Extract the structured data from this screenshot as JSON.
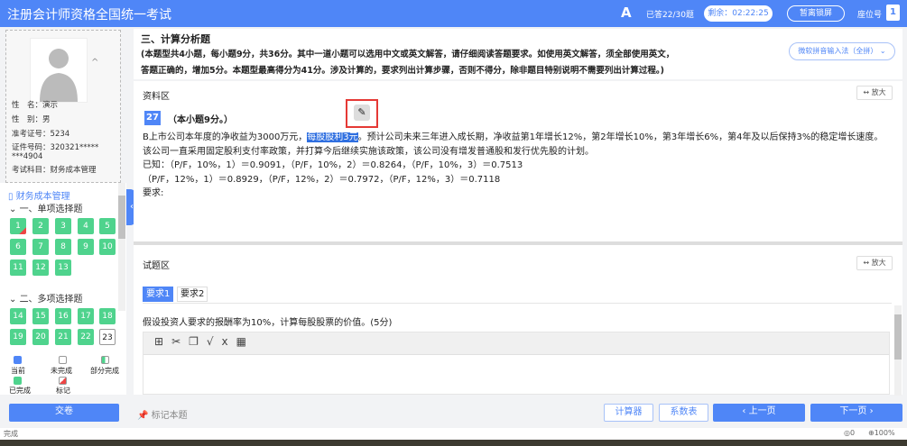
{
  "header": {
    "title": "注册会计师资格全国统一考试",
    "font_icon": "A",
    "answered": "已答22/30题",
    "remaining": "剩余：02:22:25",
    "leave": "暂离锁屏",
    "seat_label": "座位号",
    "seat_no": "1"
  },
  "candidate": {
    "rows": [
      {
        "k": "性　名",
        "v": "演示"
      },
      {
        "k": "性　别",
        "v": "男"
      },
      {
        "k": "准考证号",
        "v": "5234"
      },
      {
        "k": "证件号码",
        "v": "320321********4904"
      },
      {
        "k": "考试科目",
        "v": "财务成本管理"
      }
    ]
  },
  "nav": {
    "subject": "财务成本管理",
    "sections": [
      {
        "title": "一、单项选择题",
        "items": [
          "1",
          "2",
          "3",
          "4",
          "5",
          "6",
          "7",
          "8",
          "9",
          "10",
          "11",
          "12",
          "13"
        ]
      },
      {
        "title": "二、多项选择题",
        "items": [
          "14",
          "15",
          "16",
          "17",
          "18",
          "19",
          "20",
          "21",
          "22",
          "23"
        ]
      }
    ],
    "legend": {
      "current": "当前",
      "incomplete": "未完成",
      "partial": "部分完成",
      "done": "已完成",
      "marked": "标记"
    },
    "submit": "交卷"
  },
  "section": {
    "title": "三、计算分析题",
    "desc1": "(本题型共4小题，每小题9分，共36分。其中一道小题可以选用中文或英文解答，请仔细阅读答题要求。如使用英文解答，须全部使用英文，",
    "desc2": "答题正确的，增加5分。本题型最高得分为41分。涉及计算的，要求列出计算步骤，否则不得分，除非题目特别说明不需要列出计算过程。)",
    "ime": "微软拼音输入法（全拼）"
  },
  "material": {
    "label": "资料区",
    "zoom": "↔ 放大",
    "qno": "27",
    "qscore": "（本小题9分。）",
    "p1a": "B上市公司本年度的净收益为3000万元，",
    "p1hl": "每股股利3元",
    "p1b": "。预计公司未来三年进入成长期，净收益第1年增长12%，第2年增长10%，第3年增长6%，第4年及以后保持3%的稳定增长速度。",
    "p2": "该公司一直采用固定股利支付率政策，并打算今后继续实施该政策，该公司没有增发普通股和发行优先股的计划。",
    "p3": "已知：（P/F，10%，1）＝0.9091，（P/F，10%，2）＝0.8264，（P/F，10%，3）＝0.7513",
    "p4": "（P/F，12%，1）＝0.8929，（P/F，12%，2）＝0.7972，（P/F，12%，3）＝0.7118",
    "p5": "要求:"
  },
  "question": {
    "label": "试题区",
    "zoom": "↔ 放大",
    "tabs": [
      "要求1",
      "要求2"
    ],
    "text": "假设投资人要求的报酬率为10%，计算每股股票的价值。(5分)"
  },
  "footer": {
    "mark": "标记本题",
    "calc": "计算器",
    "table": "系数表",
    "prev": "上一页",
    "next": "下一页"
  },
  "status": {
    "left": "完成",
    "zoom": "100%",
    "count": "0"
  }
}
